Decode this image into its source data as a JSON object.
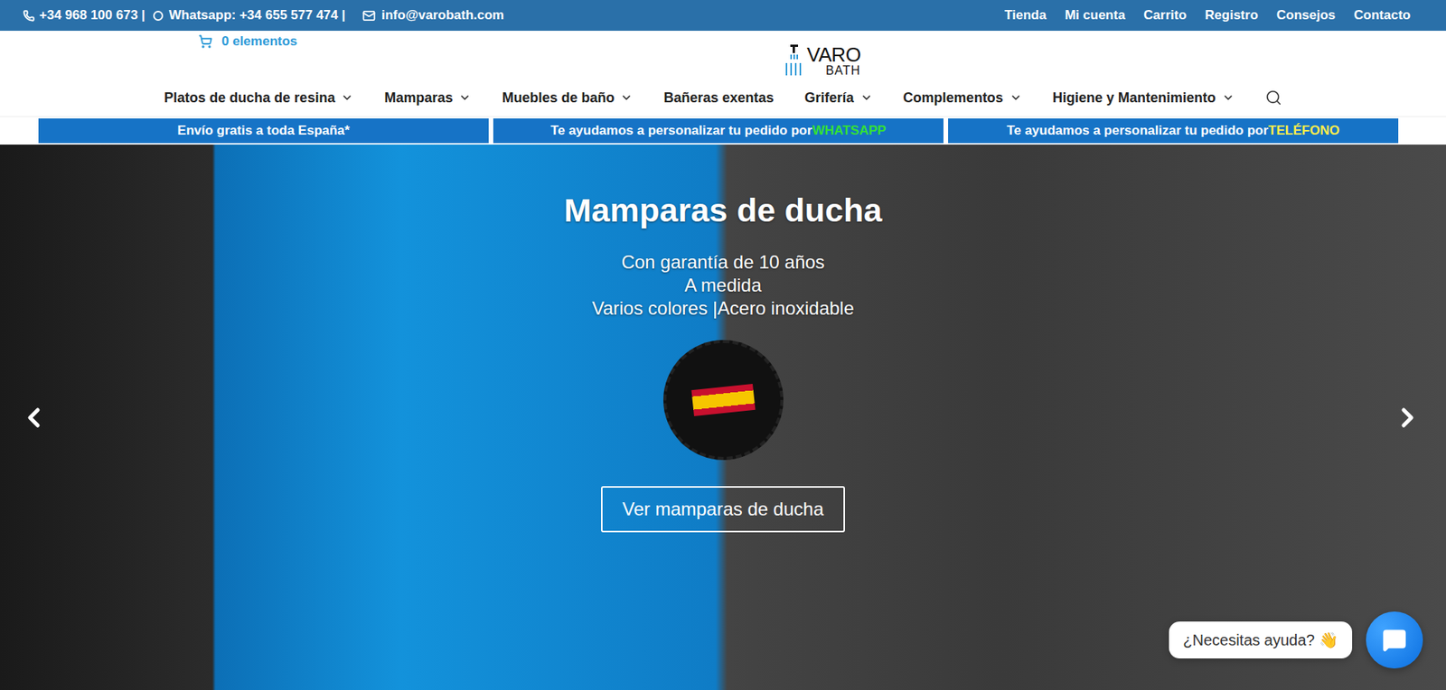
{
  "topbar": {
    "phone": "+34 968 100 673 |",
    "whatsapp": "Whatsapp: +34 655 577 474 |",
    "email": "info@varobath.com",
    "links": [
      "Tienda",
      "Mi cuenta",
      "Carrito",
      "Registro",
      "Consejos",
      "Contacto"
    ]
  },
  "cart": {
    "label": "0 elementos"
  },
  "logo": {
    "top": "VARO",
    "bottom": "BATH"
  },
  "nav": [
    {
      "label": "Platos de ducha de resina",
      "dropdown": true
    },
    {
      "label": "Mamparas",
      "dropdown": true
    },
    {
      "label": "Muebles de baño",
      "dropdown": true
    },
    {
      "label": "Bañeras exentas",
      "dropdown": false
    },
    {
      "label": "Grifería",
      "dropdown": true
    },
    {
      "label": "Complementos",
      "dropdown": true
    },
    {
      "label": "Higiene y Mantenimiento",
      "dropdown": true
    }
  ],
  "banners": [
    {
      "text": "Envío gratis a toda España*"
    },
    {
      "text": "Te ayudamos a personalizar tu pedido por ",
      "highlight": "WHATSAPP",
      "color": "#34e034"
    },
    {
      "text": "Te ayudamos a personalizar tu pedido por ",
      "highlight": "TELÉFONO",
      "color": "#ffee4a"
    }
  ],
  "hero": {
    "title": "Mamparas de ducha",
    "lines": [
      "Con garantía de 10 años",
      "A medida",
      "Varios colores |Acero inoxidable"
    ],
    "button": "Ver mamparas de ducha"
  },
  "chat": {
    "label": "¿Necesitas ayuda? 👋"
  }
}
